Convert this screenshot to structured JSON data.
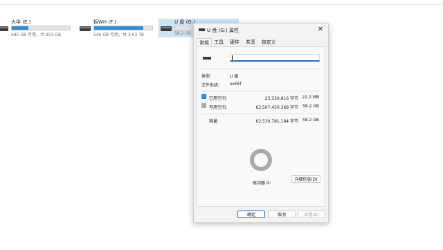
{
  "drives": [
    {
      "name": "大华 (E:)",
      "space": "685 GB 可用，共 953 GB",
      "used_fraction": 0.28
    },
    {
      "name": "拆WH (F:)",
      "space": "546 GB 可用，共 3.63 TB",
      "used_fraction": 0.85
    },
    {
      "name": "U 盘 (G:)",
      "space": "58.2 GB"
    }
  ],
  "dialog": {
    "title": "U 盘 (G:) 属性",
    "close_icon": "close-icon",
    "tabs": [
      "常规",
      "工具",
      "硬件",
      "共享",
      "自定义"
    ],
    "name_value": "",
    "type_label": "类型:",
    "type_value": "U 盘",
    "fs_label": "文件系统:",
    "fs_value": "exFAT",
    "used_label": "已用空间:",
    "used_bytes": "23,330,816 字节",
    "used_size": "22.2 MB",
    "free_label": "可用空间:",
    "free_bytes": "62,507,450,368 字节",
    "free_size": "58.2 GB",
    "capacity_label": "容量:",
    "capacity_bytes": "62,530,781,184 字节",
    "capacity_size": "58.2 GB",
    "drive_label": "驱动器 G:",
    "details_button": "详细信息(D)",
    "used_fraction": 0.004,
    "ok_button": "确定",
    "cancel_button": "取消",
    "apply_button": "应用(A)",
    "used_color": "#2b8fd4",
    "free_color": "#a9a9a9"
  }
}
